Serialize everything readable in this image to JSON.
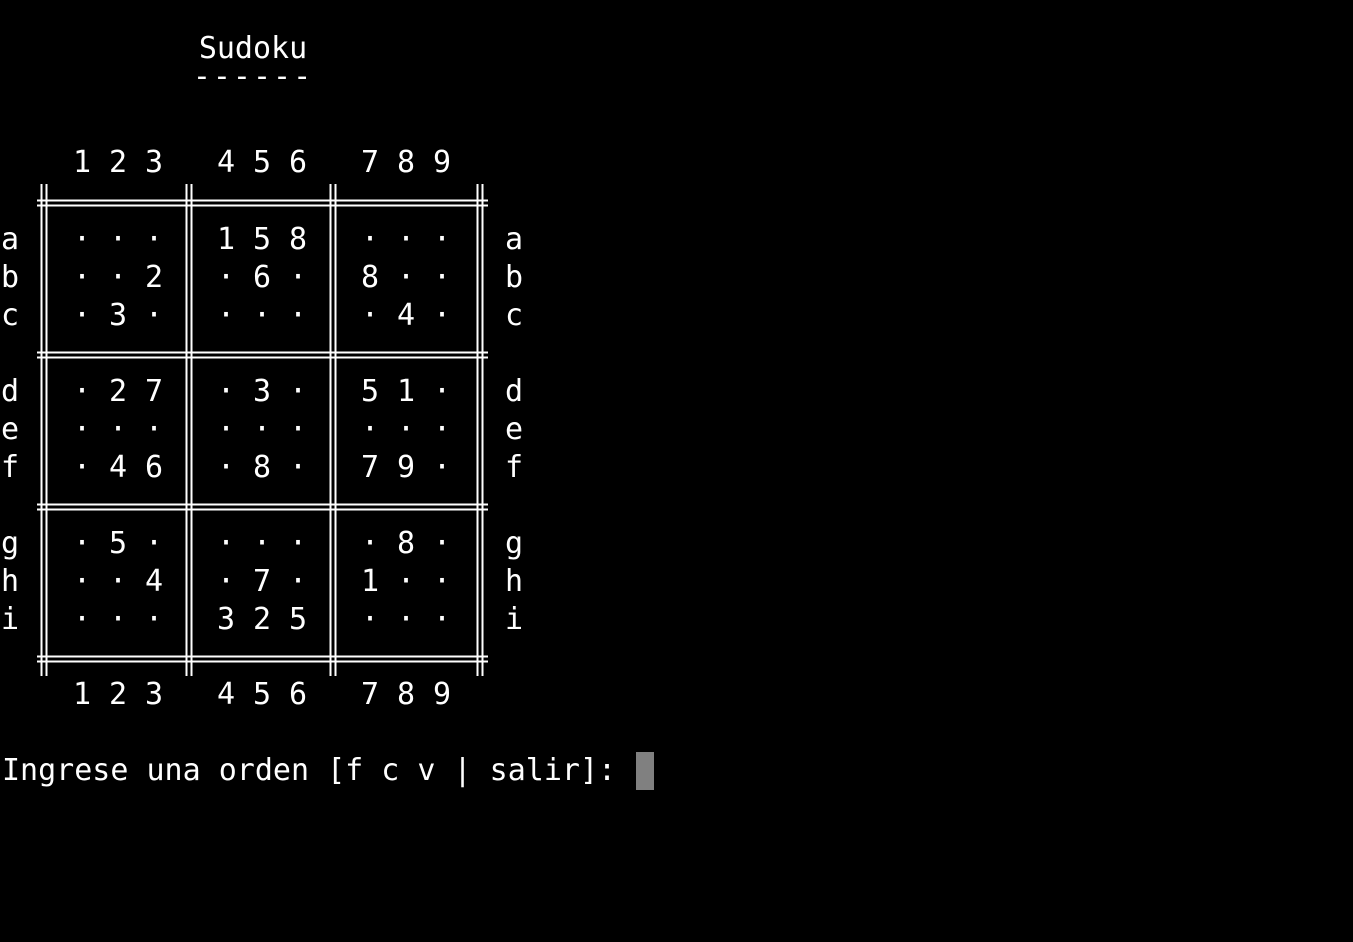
{
  "title": "Sudoku",
  "title_underline": "------",
  "column_labels": [
    "1",
    "2",
    "3",
    "4",
    "5",
    "6",
    "7",
    "8",
    "9"
  ],
  "row_labels": [
    "a",
    "b",
    "c",
    "d",
    "e",
    "f",
    "g",
    "h",
    "i"
  ],
  "empty_symbol": "·",
  "grid": [
    [
      "·",
      "·",
      "·",
      "1",
      "5",
      "8",
      "·",
      "·",
      "·"
    ],
    [
      "·",
      "·",
      "2",
      "·",
      "6",
      "·",
      "8",
      "·",
      "·"
    ],
    [
      "·",
      "3",
      "·",
      "·",
      "·",
      "·",
      "·",
      "4",
      "·"
    ],
    [
      "·",
      "2",
      "7",
      "·",
      "3",
      "·",
      "5",
      "1",
      "·"
    ],
    [
      "·",
      "·",
      "·",
      "·",
      "·",
      "·",
      "·",
      "·",
      "·"
    ],
    [
      "·",
      "4",
      "6",
      "·",
      "8",
      "·",
      "7",
      "9",
      "·"
    ],
    [
      "·",
      "5",
      "·",
      "·",
      "·",
      "·",
      "·",
      "8",
      "·"
    ],
    [
      "·",
      "·",
      "4",
      "·",
      "7",
      "·",
      "1",
      "·",
      "·"
    ],
    [
      "·",
      "·",
      "·",
      "3",
      "2",
      "5",
      "·",
      "·",
      "·"
    ]
  ],
  "prompt": "Ingrese una orden [f c v | salir]:",
  "colors": {
    "background": "#000000",
    "text": "#ffffff",
    "cursor": "#808080"
  }
}
